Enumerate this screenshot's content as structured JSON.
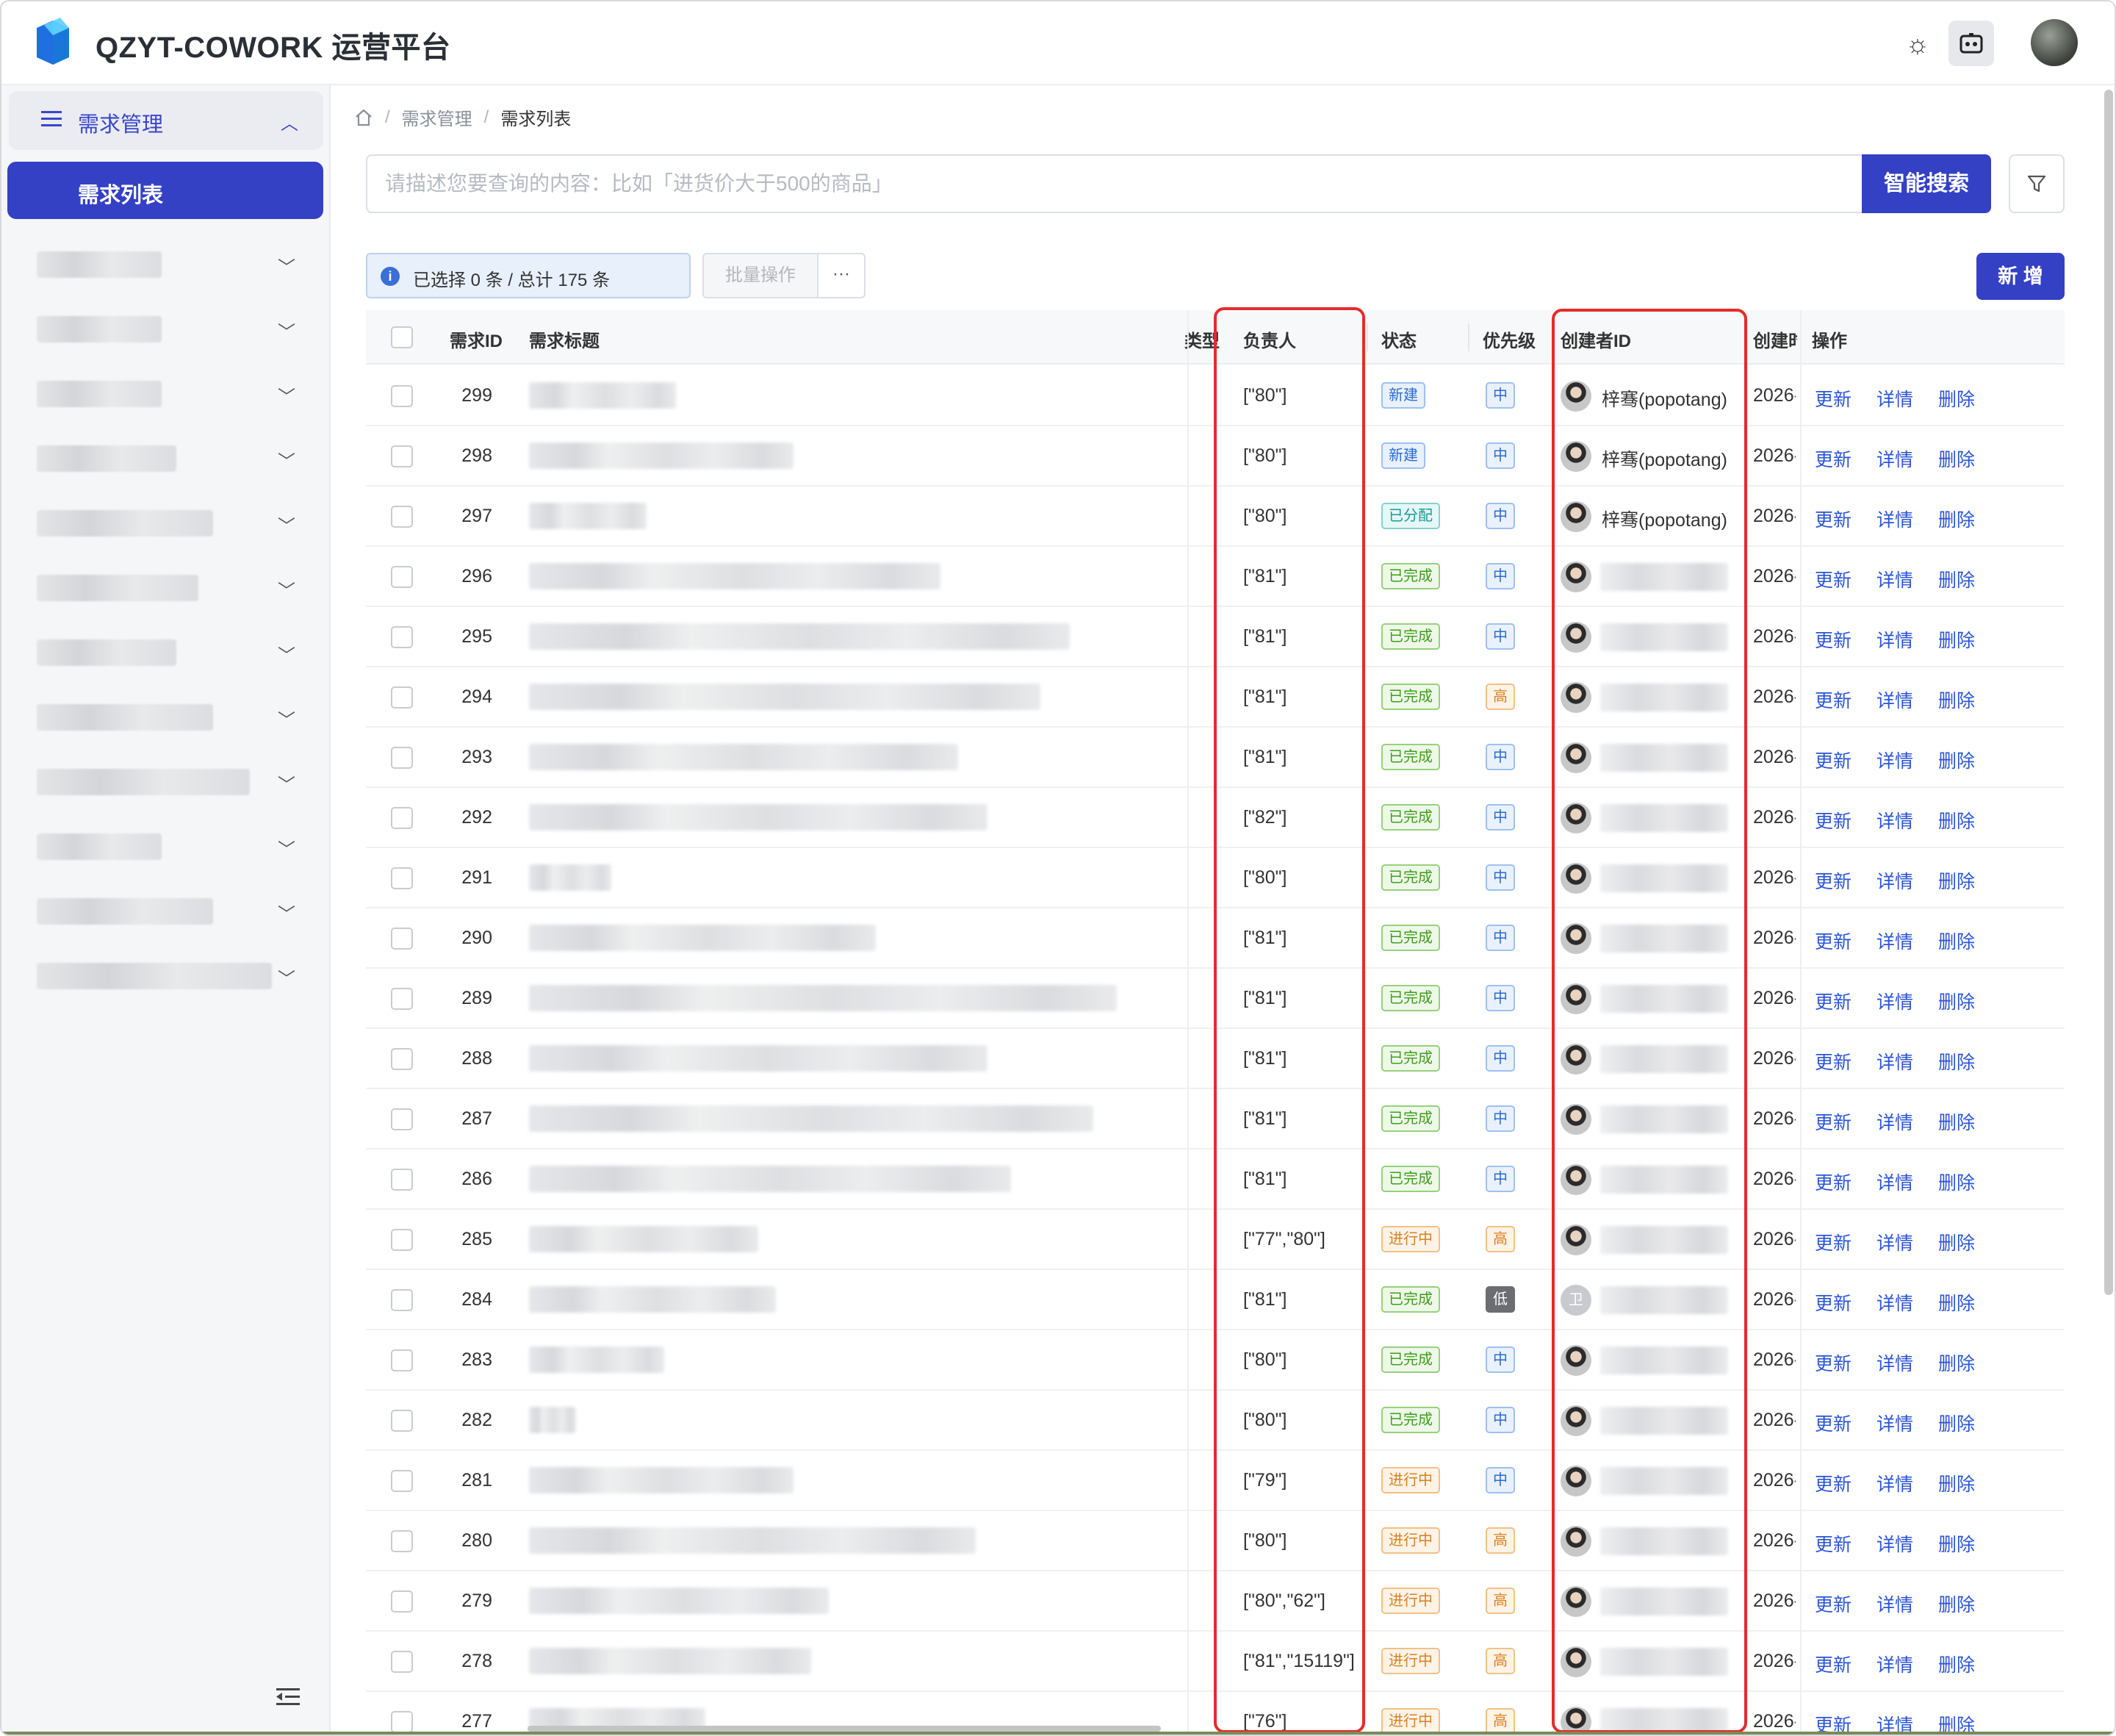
{
  "header": {
    "app_title": "QZYT-COWORK 运营平台",
    "icons": [
      "logo-icon",
      "sun-icon",
      "ai-assistant-icon",
      "user-avatar"
    ]
  },
  "sidebar": {
    "group_label": "需求管理",
    "active_item": "需求列表",
    "blurred_item_count": 12
  },
  "breadcrumb": {
    "home": "home-icon",
    "level1": "需求管理",
    "level2": "需求列表",
    "separator": "/"
  },
  "search": {
    "placeholder": "请描述您要查询的内容：比如「进货价大于500的商品」",
    "value": "",
    "button_label": "智能搜索"
  },
  "toolbar": {
    "selection_info": "已选择 0 条 / 总计 175 条",
    "batch_label": "批量操作",
    "more_label": "···",
    "add_label": "新 增"
  },
  "table": {
    "columns": [
      "需求ID",
      "需求标题",
      "类型",
      "负责人",
      "状态",
      "优先级",
      "创建者ID",
      "创建时",
      "操作"
    ],
    "actions": [
      "更新",
      "详情",
      "删除"
    ],
    "rows": [
      {
        "id": "299",
        "owner": "[\"80\"]",
        "status": "新建",
        "status_kind": "new",
        "priority": "中",
        "priority_kind": "mid",
        "creator": "梓骞(popotang)",
        "date": "2026-",
        "title_blur": 0.25
      },
      {
        "id": "298",
        "owner": "[\"80\"]",
        "status": "新建",
        "status_kind": "new",
        "priority": "中",
        "priority_kind": "mid",
        "creator": "梓骞(popotang)",
        "date": "2026-",
        "title_blur": 0.45
      },
      {
        "id": "297",
        "owner": "[\"80\"]",
        "status": "已分配",
        "status_kind": "assigned",
        "priority": "中",
        "priority_kind": "mid",
        "creator": "梓骞(popotang)",
        "date": "2026-",
        "title_blur": 0.2
      },
      {
        "id": "296",
        "owner": "[\"81\"]",
        "status": "已完成",
        "status_kind": "done",
        "priority": "中",
        "priority_kind": "mid",
        "creator": "",
        "date": "2026-",
        "title_blur": 0.7
      },
      {
        "id": "295",
        "owner": "[\"81\"]",
        "status": "已完成",
        "status_kind": "done",
        "priority": "中",
        "priority_kind": "mid",
        "creator": "",
        "date": "2026-",
        "title_blur": 0.92
      },
      {
        "id": "294",
        "owner": "[\"81\"]",
        "status": "已完成",
        "status_kind": "done",
        "priority": "高",
        "priority_kind": "high",
        "creator": "",
        "date": "2026-",
        "title_blur": 0.87
      },
      {
        "id": "293",
        "owner": "[\"81\"]",
        "status": "已完成",
        "status_kind": "done",
        "priority": "中",
        "priority_kind": "mid",
        "creator": "",
        "date": "2026-",
        "title_blur": 0.73
      },
      {
        "id": "292",
        "owner": "[\"82\"]",
        "status": "已完成",
        "status_kind": "done",
        "priority": "中",
        "priority_kind": "mid",
        "creator": "",
        "date": "2026-",
        "title_blur": 0.78
      },
      {
        "id": "291",
        "owner": "[\"80\"]",
        "status": "已完成",
        "status_kind": "done",
        "priority": "中",
        "priority_kind": "mid",
        "creator": "",
        "date": "2026-",
        "title_blur": 0.14
      },
      {
        "id": "290",
        "owner": "[\"81\"]",
        "status": "已完成",
        "status_kind": "done",
        "priority": "中",
        "priority_kind": "mid",
        "creator": "",
        "date": "2026-",
        "title_blur": 0.59
      },
      {
        "id": "289",
        "owner": "[\"81\"]",
        "status": "已完成",
        "status_kind": "done",
        "priority": "中",
        "priority_kind": "mid",
        "creator": "",
        "date": "2026-",
        "title_blur": 1.0
      },
      {
        "id": "288",
        "owner": "[\"81\"]",
        "status": "已完成",
        "status_kind": "done",
        "priority": "中",
        "priority_kind": "mid",
        "creator": "",
        "date": "2026-",
        "title_blur": 0.78
      },
      {
        "id": "287",
        "owner": "[\"81\"]",
        "status": "已完成",
        "status_kind": "done",
        "priority": "中",
        "priority_kind": "mid",
        "creator": "",
        "date": "2026-",
        "title_blur": 0.96
      },
      {
        "id": "286",
        "owner": "[\"81\"]",
        "status": "已完成",
        "status_kind": "done",
        "priority": "中",
        "priority_kind": "mid",
        "creator": "",
        "date": "2026-",
        "title_blur": 0.82
      },
      {
        "id": "285",
        "owner": "[\"77\",\"80\"]",
        "status": "进行中",
        "status_kind": "progress",
        "priority": "高",
        "priority_kind": "high",
        "creator": "",
        "date": "2026-",
        "title_blur": 0.39
      },
      {
        "id": "284",
        "owner": "[\"81\"]",
        "status": "已完成",
        "status_kind": "done",
        "priority": "低",
        "priority_kind": "low",
        "creator": "",
        "date": "2026-",
        "title_blur": 0.42,
        "avatar_text": "卫"
      },
      {
        "id": "283",
        "owner": "[\"80\"]",
        "status": "已完成",
        "status_kind": "done",
        "priority": "中",
        "priority_kind": "mid",
        "creator": "",
        "date": "2026-",
        "title_blur": 0.23
      },
      {
        "id": "282",
        "owner": "[\"80\"]",
        "status": "已完成",
        "status_kind": "done",
        "priority": "中",
        "priority_kind": "mid",
        "creator": "",
        "date": "2026-",
        "title_blur": 0.08
      },
      {
        "id": "281",
        "owner": "[\"79\"]",
        "status": "进行中",
        "status_kind": "progress",
        "priority": "中",
        "priority_kind": "mid",
        "creator": "",
        "date": "2026-",
        "title_blur": 0.45
      },
      {
        "id": "280",
        "owner": "[\"80\"]",
        "status": "进行中",
        "status_kind": "progress",
        "priority": "高",
        "priority_kind": "high",
        "creator": "",
        "date": "2026-",
        "title_blur": 0.76
      },
      {
        "id": "279",
        "owner": "[\"80\",\"62\"]",
        "status": "进行中",
        "status_kind": "progress",
        "priority": "高",
        "priority_kind": "high",
        "creator": "",
        "date": "2026-",
        "title_blur": 0.51
      },
      {
        "id": "278",
        "owner": "[\"81\",\"15119\"]",
        "status": "进行中",
        "status_kind": "progress",
        "priority": "高",
        "priority_kind": "high",
        "creator": "",
        "date": "2026-",
        "title_blur": 0.48
      },
      {
        "id": "277",
        "owner": "[\"76\"]",
        "status": "进行中",
        "status_kind": "progress",
        "priority": "高",
        "priority_kind": "high",
        "creator": "",
        "date": "2026-",
        "title_blur": 0.3
      }
    ]
  },
  "colors": {
    "primary": "#3441c4",
    "link": "#2c55d6",
    "highlight_box": "#e52b2b"
  }
}
